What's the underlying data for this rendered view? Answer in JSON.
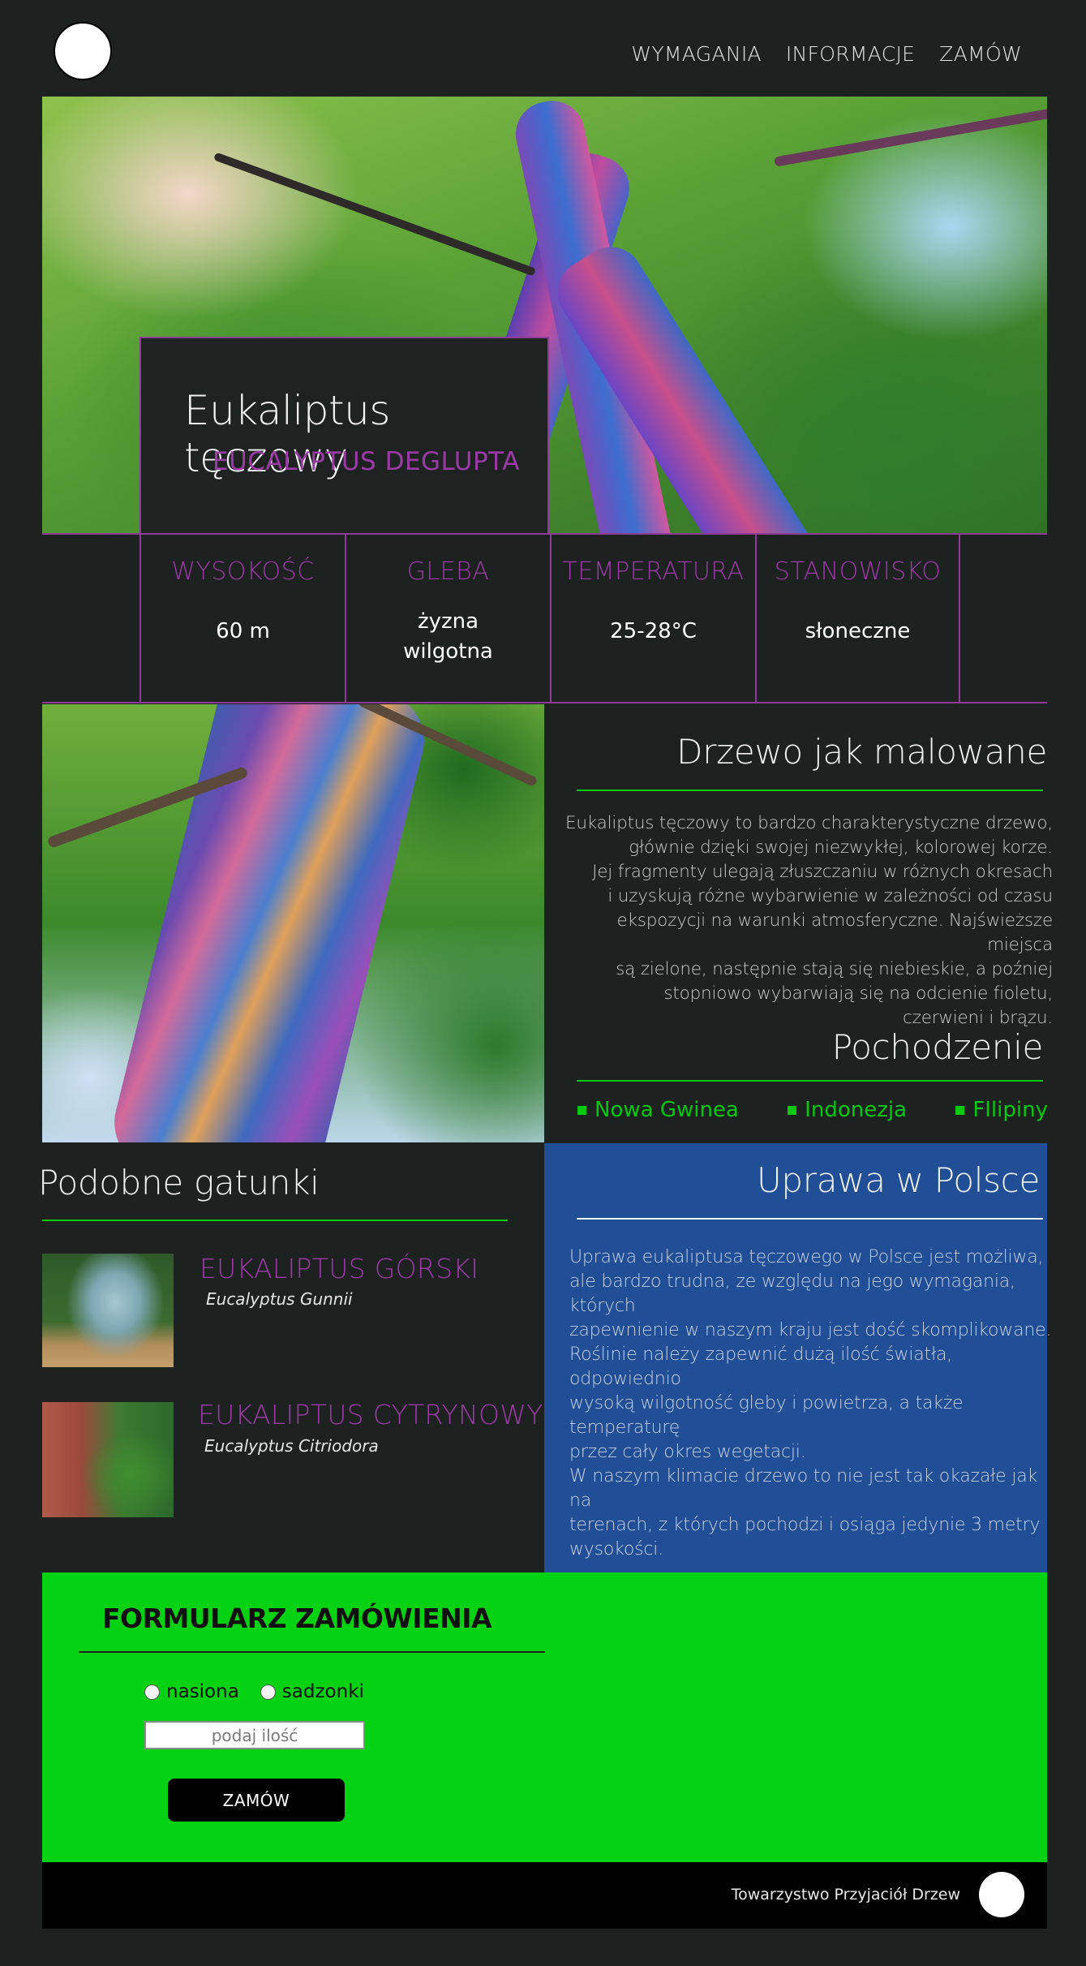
{
  "header": {
    "nav": [
      "WYMAGANIA",
      "INFORMACJE",
      "ZAMÓW"
    ]
  },
  "hero": {
    "title": "Eukaliptus tęczowy",
    "subtitle": "EUCALYPTUS DEGLUPTA"
  },
  "stats": [
    {
      "label": "WYSOKOŚĆ",
      "value": "60 m"
    },
    {
      "label": "GLEBA",
      "value_lines": [
        "żyzna",
        "wilgotna"
      ]
    },
    {
      "label": "TEMPERATURA",
      "value": "25-28°C"
    },
    {
      "label": "STANOWISKO",
      "value": "słoneczne"
    }
  ],
  "about": {
    "title": "Drzewo jak malowane",
    "lines": [
      "Eukaliptus tęczowy to bardzo charakterystyczne drzewo,",
      "głównie dzięki swojej niezwykłej, kolorowej korze.",
      "Jej fragmenty ulegają złuszczaniu w różnych okresach",
      "i uzyskują różne wybarwienie w zależności od czasu",
      "ekspozycji na warunki atmosferyczne. Najświeższe miejsca",
      "są zielone, następnie stają się niebieskie, a poźniej",
      "stopniowo wybarwiają się na odcienie fioletu,",
      "czerwieni i brązu."
    ]
  },
  "origin": {
    "title": "Pochodzenie",
    "items": [
      "Nowa Gwinea",
      "Indonezja",
      "FIlipiny"
    ]
  },
  "similar": {
    "title": "Podobne gatunki",
    "items": [
      {
        "name": "EUKALIPTUS GÓRSKI",
        "latin": "Eucalyptus Gunnii"
      },
      {
        "name": "EUKALIPTUS CYTRYNOWY",
        "latin": "Eucalyptus Citriodora"
      }
    ]
  },
  "poland": {
    "title": "Uprawa w Polsce",
    "lines": [
      "Uprawa eukaliptusa tęczowego w Polsce jest możliwa,",
      "ale bardzo trudna, ze względu na jego wymagania, których",
      "zapewnienie w naszym kraju jest dość skomplikowane.",
      "Roślinie należy zapewnić dużą ilość światła, odpowiednio",
      "wysoką wilgotność gleby i powietrza, a także temperaturę",
      "przez cały okres wegetacji.",
      "W naszym klimacie drzewo to nie jest tak okazałe jak na",
      "terenach, z których pochodzi i osiąga jedynie 3 metry",
      "wysokości."
    ]
  },
  "form": {
    "title": "FORMULARZ ZAMÓWIENIA",
    "options": [
      "nasiona",
      "sadzonki"
    ],
    "quantity_placeholder": "podaj ilość",
    "submit_label": "ZAMÓW"
  },
  "footer": {
    "text": "Towarzystwo Przyjaciół Drzew"
  },
  "colors": {
    "background": "#1d2220",
    "accent_purple": "#9b3aa6",
    "accent_green": "#05c90f",
    "panel_blue": "#204f97",
    "form_green": "#05d212"
  }
}
